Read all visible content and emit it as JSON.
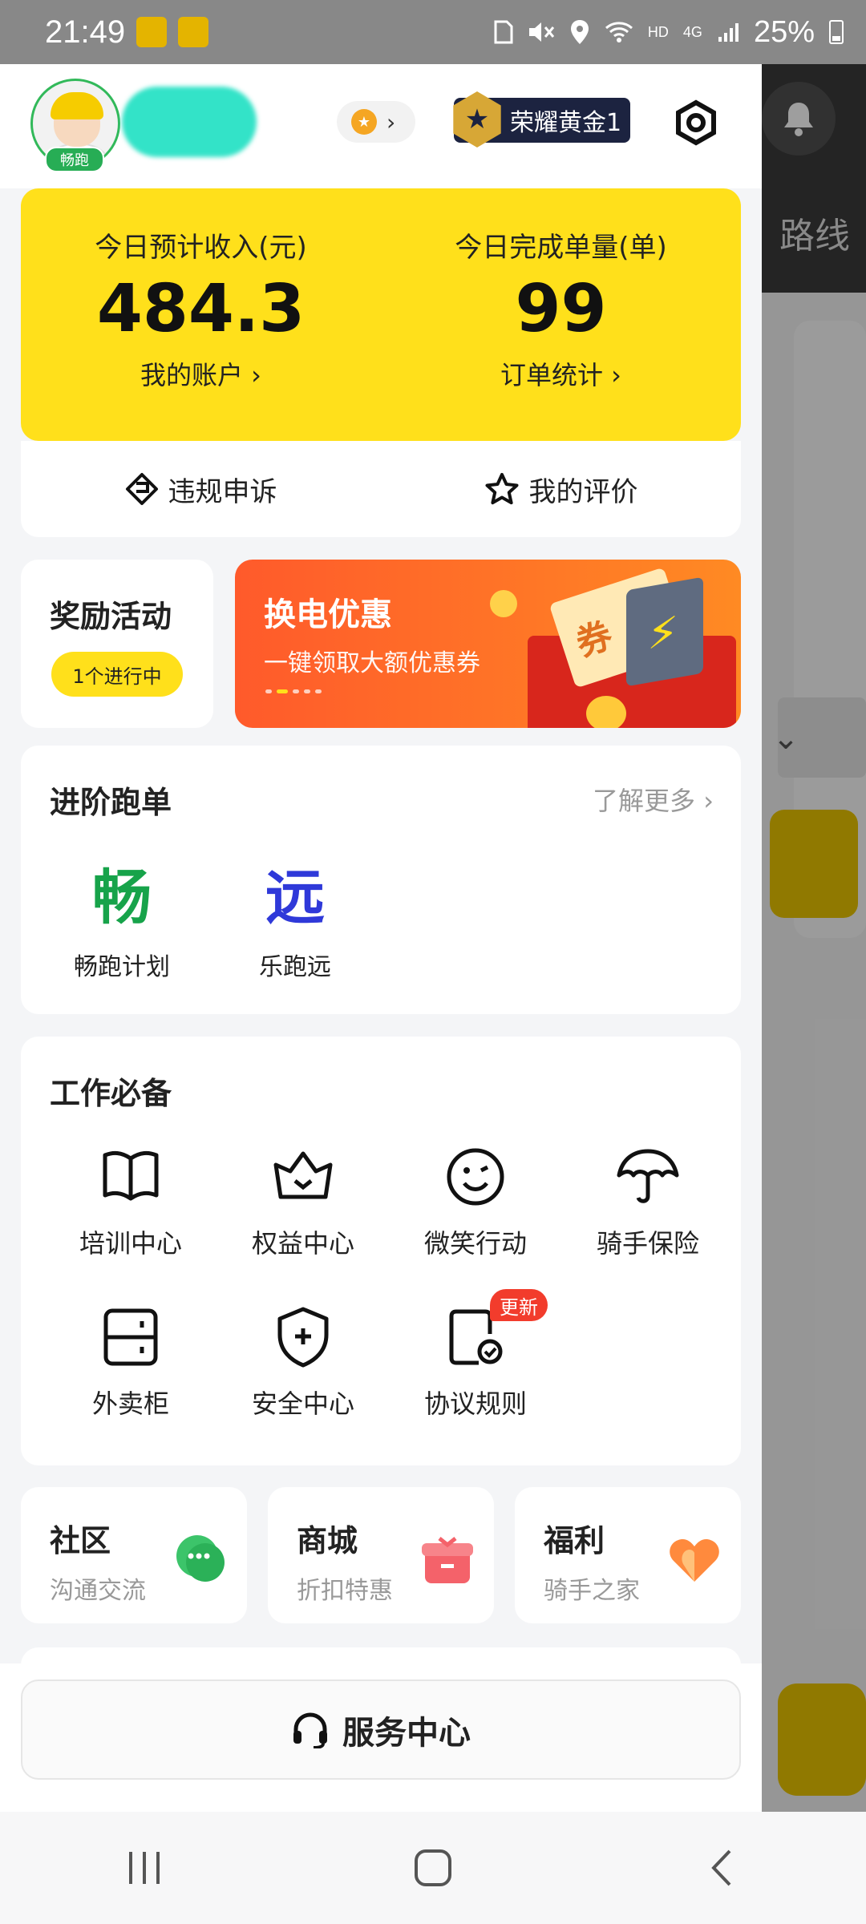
{
  "status_bar": {
    "time": "21:49",
    "network": "HD",
    "cell": "4G",
    "battery": "25%"
  },
  "header": {
    "avatar_badge": "畅跑",
    "rank_label": "荣耀黄金1"
  },
  "income": {
    "left": {
      "label": "今日预计收入(元)",
      "value": "484.3",
      "link": "我的账户 ›"
    },
    "right": {
      "label": "今日完成单量(单)",
      "value": "99",
      "link": "订单统计 ›"
    }
  },
  "quick_actions": [
    {
      "label": "违规申诉",
      "icon": "diamond-flag-icon"
    },
    {
      "label": "我的评价",
      "icon": "star-icon"
    }
  ],
  "reward": {
    "title": "奖励活动",
    "status": "1个进行中"
  },
  "banner": {
    "title": "换电优惠",
    "subtitle": "一键领取大额优惠券",
    "ticket_text": "券"
  },
  "advanced": {
    "title": "进阶跑单",
    "more": "了解更多 ›",
    "items": [
      {
        "glyph": "畅",
        "label": "畅跑计划",
        "color": "#17a34a"
      },
      {
        "glyph": "远",
        "label": "乐跑远",
        "color": "#2f39d9"
      }
    ]
  },
  "tools": {
    "title": "工作必备",
    "items": [
      {
        "label": "培训中心",
        "icon": "book-icon"
      },
      {
        "label": "权益中心",
        "icon": "crown-icon"
      },
      {
        "label": "微笑行动",
        "icon": "smile-icon"
      },
      {
        "label": "骑手保险",
        "icon": "umbrella-icon"
      },
      {
        "label": "外卖柜",
        "icon": "locker-icon"
      },
      {
        "label": "安全中心",
        "icon": "shield-icon"
      },
      {
        "label": "协议规则",
        "icon": "document-check-icon",
        "badge": "更新"
      }
    ]
  },
  "mini_cards": [
    {
      "title": "社区",
      "subtitle": "沟通交流",
      "icon": "chat-icon"
    },
    {
      "title": "商城",
      "subtitle": "折扣特惠",
      "icon": "gift-icon"
    },
    {
      "title": "福利",
      "subtitle": "骑手之家",
      "icon": "heart-icon"
    }
  ],
  "service": {
    "label": "服务中心"
  },
  "background_app": {
    "visible_text": "路线"
  },
  "colors": {
    "primary_yellow": "#ffe01b",
    "banner_orange": "#ff5a2b",
    "green": "#17a34a",
    "blue": "#2f39d9",
    "badge_red": "#f23c2c"
  }
}
